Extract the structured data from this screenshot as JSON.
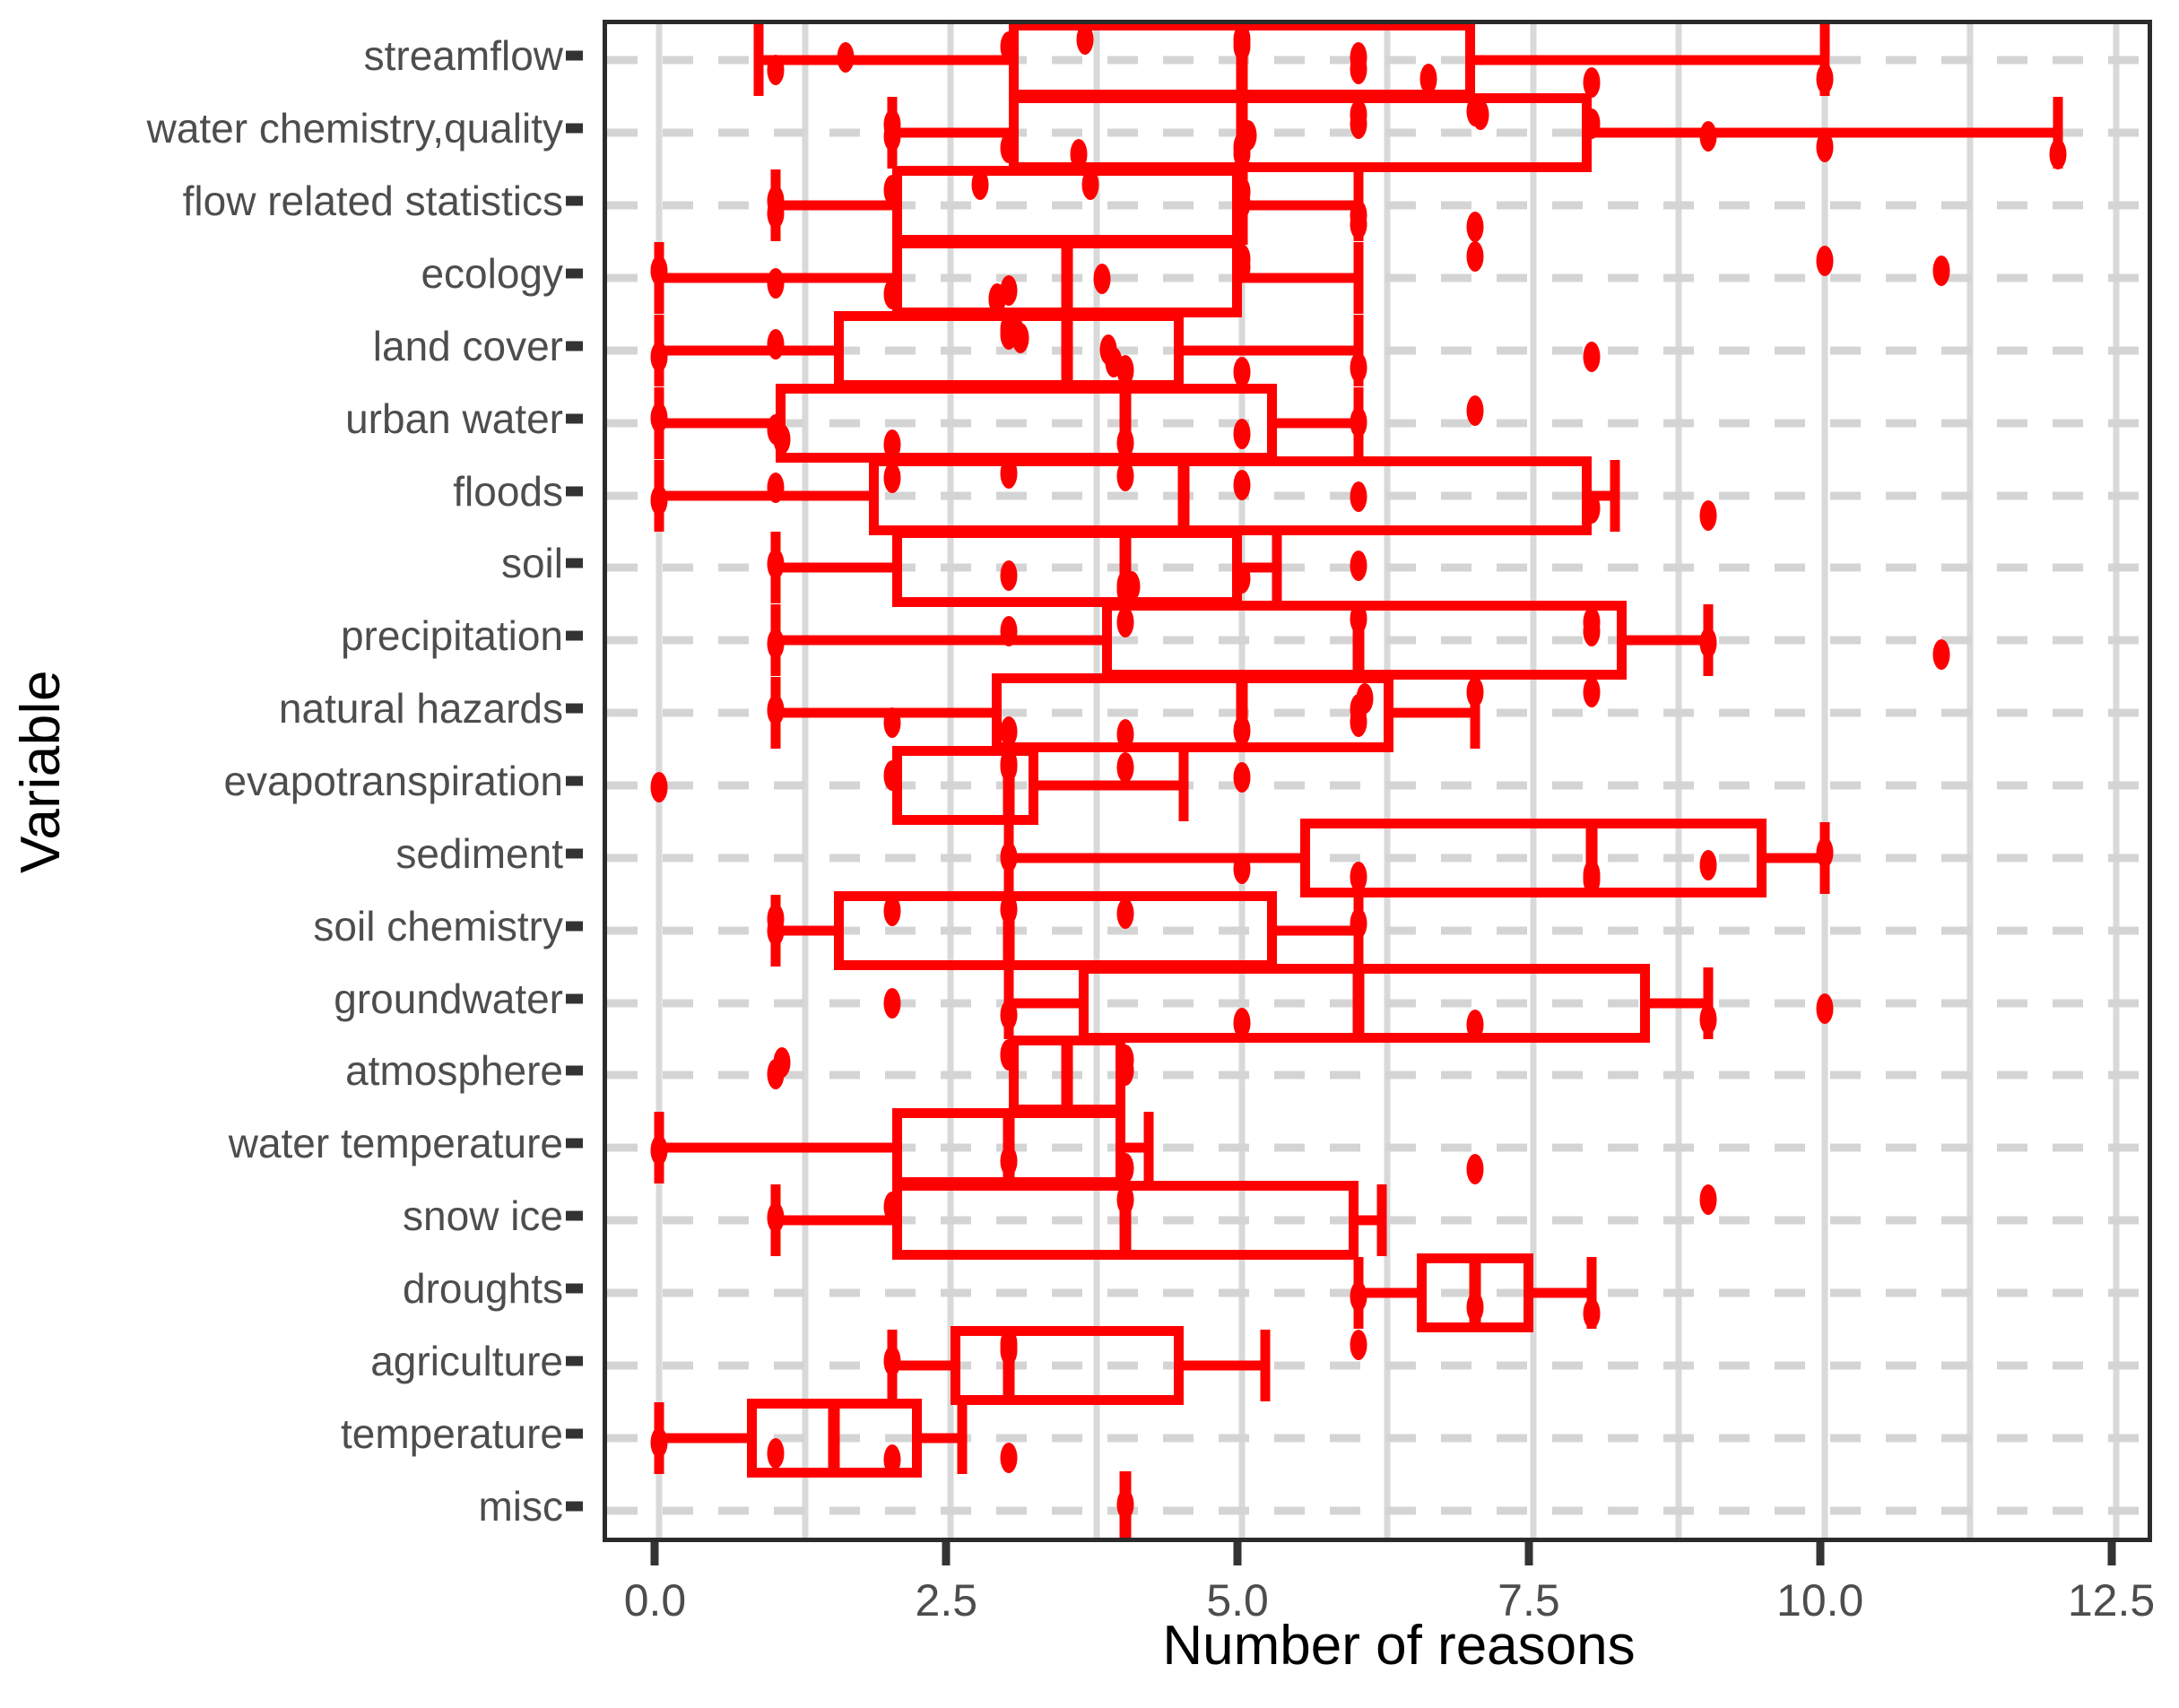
{
  "chart_data": {
    "type": "box",
    "title": "",
    "xlabel": "Number of reasons",
    "ylabel": "Variable",
    "xlim": [
      -0.45,
      12.85
    ],
    "xticks": [
      0.0,
      2.5,
      5.0,
      7.5,
      10.0,
      12.5
    ],
    "xtick_labels": [
      "0.0",
      "2.5",
      "5.0",
      "7.5",
      "10.0",
      "12.5"
    ],
    "grid": "major-and-minor dashed light grey; horizontal dashed at each category",
    "legend": "none",
    "orientation": "horizontal",
    "box_color": "#ff0000",
    "point_color": "#ff0000",
    "categories": [
      "streamflow",
      "water chemistry,quality",
      "flow related statistics",
      "ecology",
      "land cover",
      "urban water",
      "floods",
      "soil",
      "precipitation",
      "natural hazards",
      "evapotranspiration",
      "sediment",
      "soil chemistry",
      "groundwater",
      "atmosphere",
      "water temperature",
      "snow ice",
      "droughts",
      "agriculture",
      "temperature",
      "misc"
    ],
    "boxes": [
      {
        "category": "streamflow",
        "whisker_low": 0.85,
        "q1": 3.0,
        "median": 5.0,
        "q3": 7.0,
        "whisker_high": 10.0,
        "points": [
          1.0,
          1.6,
          3.0,
          3.65,
          5.0,
          5.0,
          6.0,
          6.0,
          6.6,
          8.0,
          10.0
        ]
      },
      {
        "category": "water chemistry,quality",
        "whisker_low": 2.0,
        "q1": 3.0,
        "median": 5.0,
        "q3": 8.0,
        "whisker_high": 12.0,
        "points": [
          2.0,
          2.0,
          3.0,
          3.6,
          5.0,
          5.0,
          5.05,
          6.0,
          6.0,
          7.0,
          7.05,
          8.0,
          9.0,
          10.0,
          12.0
        ]
      },
      {
        "category": "flow related statistics",
        "whisker_low": 1.0,
        "q1": 2.0,
        "median": 5.0,
        "q3": 5.0,
        "whisker_high": 6.0,
        "points": [
          1.0,
          1.0,
          2.0,
          2.75,
          3.7,
          5.0,
          5.0,
          6.0,
          6.0,
          7.0
        ]
      },
      {
        "category": "ecology",
        "whisker_low": 0.0,
        "q1": 2.0,
        "median": 3.5,
        "q3": 5.0,
        "whisker_high": 6.0,
        "points": [
          0.0,
          1.0,
          2.0,
          2.9,
          2.9,
          3.0,
          3.8,
          5.0,
          5.0,
          7.0,
          10.0,
          11.0
        ]
      },
      {
        "category": "land cover",
        "whisker_low": 0.0,
        "q1": 1.5,
        "median": 3.5,
        "q3": 4.5,
        "whisker_high": 6.0,
        "points": [
          0.0,
          1.0,
          3.0,
          3.0,
          3.05,
          3.1,
          3.85,
          3.9,
          4.0,
          5.0,
          6.0,
          8.0
        ]
      },
      {
        "category": "urban water",
        "whisker_low": 0.0,
        "q1": 1.0,
        "median": 4.0,
        "q3": 5.3,
        "whisker_high": 6.0,
        "points": [
          0.0,
          1.0,
          1.05,
          2.0,
          4.0,
          5.0,
          6.0,
          7.0
        ]
      },
      {
        "category": "floods",
        "whisker_low": 0.0,
        "q1": 1.8,
        "median": 4.5,
        "q3": 8.0,
        "whisker_high": 8.2,
        "points": [
          0.0,
          1.0,
          2.0,
          3.0,
          4.0,
          5.0,
          6.0,
          8.0,
          9.0
        ]
      },
      {
        "category": "soil",
        "whisker_low": 1.0,
        "q1": 2.0,
        "median": 4.0,
        "q3": 5.0,
        "whisker_high": 5.3,
        "points": [
          1.0,
          3.0,
          4.0,
          4.0,
          4.05,
          5.0,
          6.0
        ]
      },
      {
        "category": "precipitation",
        "whisker_low": 1.0,
        "q1": 3.8,
        "median": 6.0,
        "q3": 8.3,
        "whisker_high": 9.0,
        "points": [
          1.0,
          3.0,
          4.0,
          6.0,
          8.0,
          8.0,
          9.0,
          11.0
        ]
      },
      {
        "category": "natural hazards",
        "whisker_low": 1.0,
        "q1": 2.85,
        "median": 5.0,
        "q3": 6.3,
        "whisker_high": 7.0,
        "points": [
          1.0,
          2.0,
          3.0,
          4.0,
          5.0,
          6.0,
          6.0,
          6.05,
          7.0,
          8.0
        ]
      },
      {
        "category": "evapotranspiration",
        "whisker_low": 3.0,
        "q1": 2.0,
        "median": 3.0,
        "q3": 3.25,
        "whisker_high": 4.5,
        "points": [
          0.0,
          2.0,
          3.0,
          3.0,
          4.0,
          5.0
        ]
      },
      {
        "category": "sediment",
        "whisker_low": 3.0,
        "q1": 5.5,
        "median": 8.0,
        "q3": 9.5,
        "whisker_high": 10.0,
        "points": [
          3.0,
          5.0,
          6.0,
          8.0,
          8.0,
          9.0,
          10.0
        ]
      },
      {
        "category": "soil chemistry",
        "whisker_low": 1.0,
        "q1": 1.5,
        "median": 3.0,
        "q3": 5.3,
        "whisker_high": 6.0,
        "points": [
          1.0,
          1.0,
          2.0,
          3.0,
          4.0,
          6.0
        ]
      },
      {
        "category": "groundwater",
        "whisker_low": 3.0,
        "q1": 3.6,
        "median": 6.0,
        "q3": 8.5,
        "whisker_high": 9.0,
        "points": [
          2.0,
          3.0,
          5.0,
          7.0,
          9.0,
          10.0
        ]
      },
      {
        "category": "atmosphere",
        "whisker_low": 3.0,
        "q1": 3.0,
        "median": 3.5,
        "q3": 4.0,
        "whisker_high": 4.0,
        "points": [
          1.0,
          1.05,
          3.0,
          3.0,
          4.0,
          4.0
        ]
      },
      {
        "category": "water temperature",
        "whisker_low": 0.0,
        "q1": 2.0,
        "median": 3.0,
        "q3": 4.0,
        "whisker_high": 4.2,
        "points": [
          0.0,
          3.0,
          4.0,
          7.0
        ]
      },
      {
        "category": "snow ice",
        "whisker_low": 1.0,
        "q1": 2.0,
        "median": 4.0,
        "q3": 6.0,
        "whisker_high": 6.2,
        "points": [
          1.0,
          2.0,
          4.0,
          9.0
        ]
      },
      {
        "category": "droughts",
        "whisker_low": 6.0,
        "q1": 6.5,
        "median": 7.0,
        "q3": 7.5,
        "whisker_high": 8.0,
        "points": [
          6.0,
          7.0,
          8.0
        ]
      },
      {
        "category": "agriculture",
        "whisker_low": 2.0,
        "q1": 2.5,
        "median": 3.0,
        "q3": 4.5,
        "whisker_high": 5.2,
        "points": [
          2.0,
          3.0,
          3.0,
          6.0
        ]
      },
      {
        "category": "temperature",
        "whisker_low": 0.0,
        "q1": 0.75,
        "median": 1.5,
        "q3": 2.25,
        "whisker_high": 2.6,
        "points": [
          0.0,
          1.0,
          2.0,
          3.0
        ]
      },
      {
        "category": "misc",
        "whisker_low": 4.0,
        "q1": 4.0,
        "median": 4.0,
        "q3": 4.0,
        "whisker_high": 4.0,
        "points": [
          4.0
        ]
      }
    ]
  },
  "axes": {
    "x_title": "Number of reasons",
    "y_title": "Variable"
  }
}
